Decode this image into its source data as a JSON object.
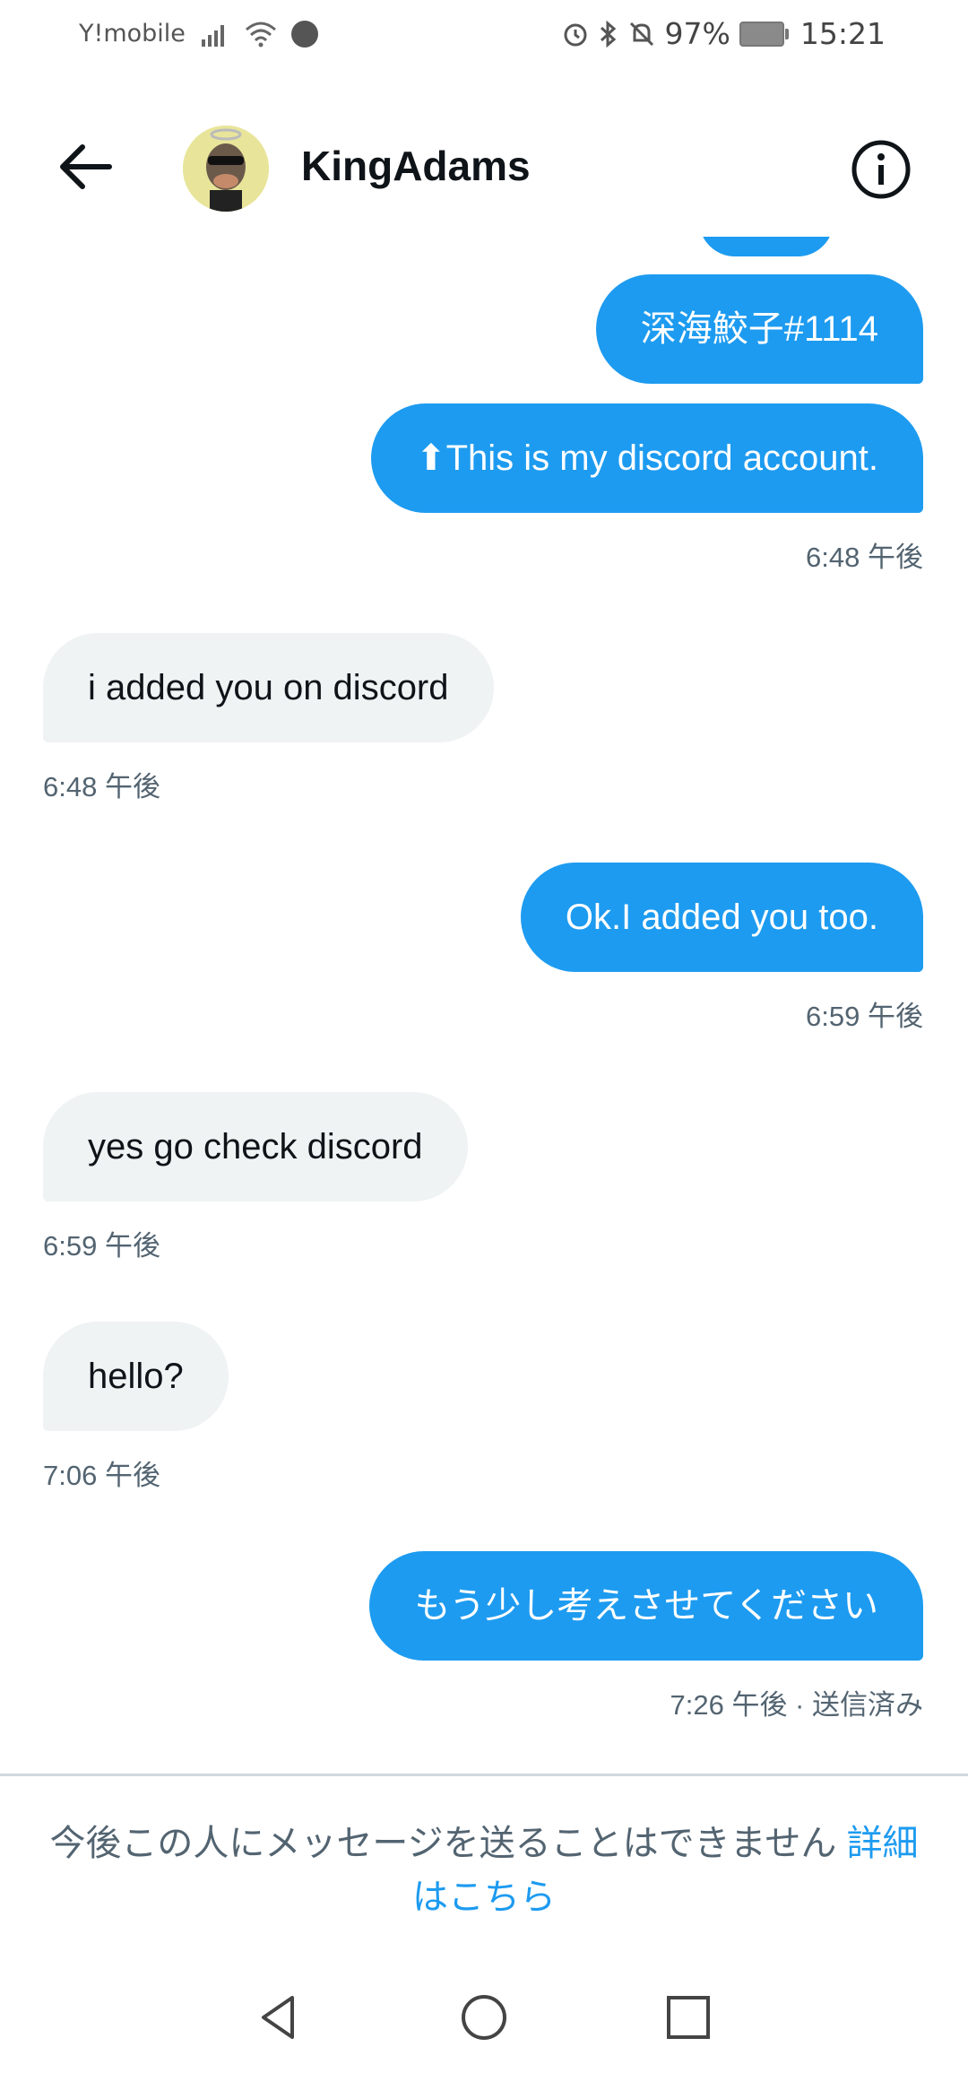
{
  "status_bar": {
    "carrier": "Y!mobile",
    "battery": "97%",
    "time": "15:21"
  },
  "header": {
    "title": "KingAdams"
  },
  "messages": [
    {
      "direction": "sent",
      "text": "深海鮫子#1114"
    },
    {
      "direction": "sent",
      "text": "⬆This is my  discord account.",
      "time": "6:48 午後"
    },
    {
      "direction": "received",
      "text": "i added you on discord",
      "time": "6:48 午後"
    },
    {
      "direction": "sent",
      "text": "Ok.I added you too.",
      "time": "6:59 午後"
    },
    {
      "direction": "received",
      "text": "yes go check discord",
      "time": "6:59 午後"
    },
    {
      "direction": "received",
      "text": "hello?",
      "time": "7:06 午後"
    },
    {
      "direction": "sent",
      "text": "もう少し考えさせてください",
      "time": "7:26 午後 · 送信済み"
    }
  ],
  "footer": {
    "notice": "今後この人にメッセージを送ることはできません ",
    "link": "詳細はこちら"
  },
  "colors": {
    "sent_bubble": "#1d9bf0",
    "received_bubble": "#eff3f4",
    "link": "#1d9bf0"
  },
  "icons": [
    "back-arrow-icon",
    "avatar",
    "info-icon",
    "nav-back-icon",
    "nav-home-icon",
    "nav-recents-icon"
  ]
}
